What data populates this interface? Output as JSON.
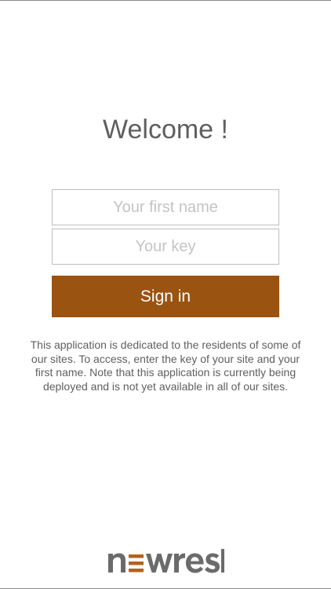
{
  "app": {
    "title": "Welcome !"
  },
  "form": {
    "first_name_placeholder": "Your first name",
    "first_name_value": "",
    "key_placeholder": "Your key",
    "key_value": "",
    "submit_label": "Sign in"
  },
  "info": {
    "text": "This application is dedicated to the residents of some of our sites. To access, enter the key of your site and your first name. Note that this application is currently being deployed and is not yet available in all of our sites."
  },
  "footer": {
    "logo_text": "newrest",
    "logo_icon": "newrest-logo"
  },
  "colors": {
    "accent": "#9b5312",
    "logo_gray": "#6b6b6b",
    "text_gray": "#5f5f5f"
  }
}
